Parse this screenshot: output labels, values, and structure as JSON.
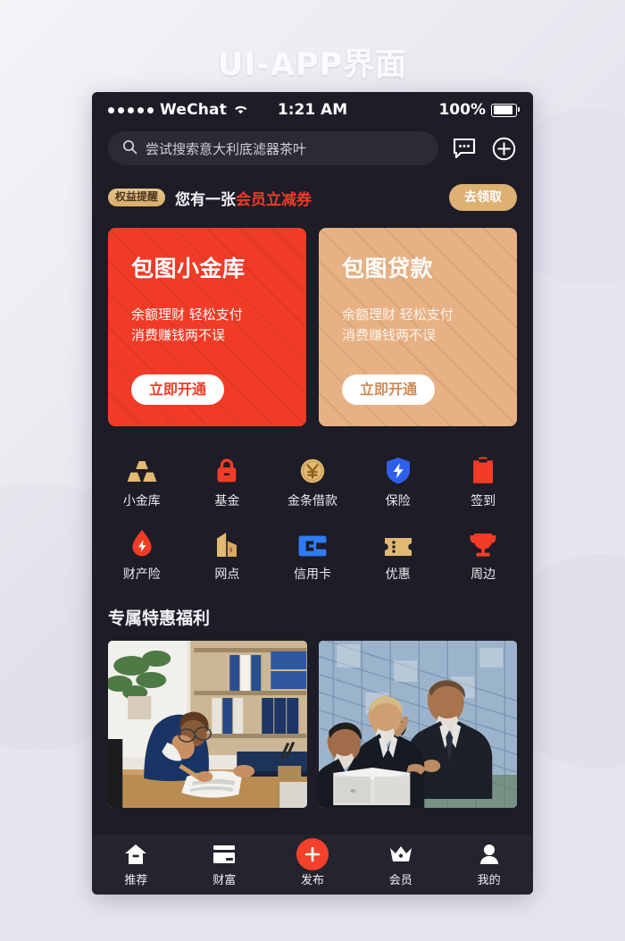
{
  "page": {
    "title": "UI-APP界面"
  },
  "statusbar": {
    "carrier": "WeChat",
    "time": "1:21 AM",
    "battery_percent": "100%",
    "signal_dots": 5,
    "wifi_icon": "wifi-icon",
    "battery_icon": "battery-full-icon"
  },
  "search": {
    "placeholder": "尝试搜索意大利底滤器茶叶",
    "icon": "search-icon",
    "message_icon": "message-bubble-icon",
    "add_icon": "plus-circle-icon"
  },
  "notice": {
    "badge": "权益提醒",
    "text_prefix": "您有一张",
    "text_highlight": "会员立减券",
    "button": "去领取",
    "badge_color": "#d9ad6c",
    "highlight_color": "#ef3b26",
    "button_color": "#dcb173"
  },
  "promo_cards": [
    {
      "title": "包图小金库",
      "sub_line1": "余额理财 轻松支付",
      "sub_line2": "消费赚钱两不误",
      "button": "立即开通",
      "bg_color": "#f03c27",
      "button_text_color": "#f03c27"
    },
    {
      "title": "包图贷款",
      "sub_line1": "余额理财 轻松支付",
      "sub_line2": "消费赚钱两不误",
      "button": "立即开通",
      "bg_color": "#e8b184",
      "button_text_color": "#cf8a55"
    }
  ],
  "quick_grid": {
    "row1": [
      {
        "label": "小金库",
        "icon": "gold-bars-icon",
        "color": "#e2b972"
      },
      {
        "label": "基金",
        "icon": "lock-bag-icon",
        "color": "#f23c26"
      },
      {
        "label": "金条借款",
        "icon": "yuan-coin-icon",
        "color": "#e2b972"
      },
      {
        "label": "保险",
        "icon": "shield-bolt-icon",
        "color": "#2f5fe8"
      },
      {
        "label": "签到",
        "icon": "clipboard-icon",
        "color": "#f23c26"
      }
    ],
    "row2": [
      {
        "label": "财产险",
        "icon": "droplet-bolt-icon",
        "color": "#f23c26"
      },
      {
        "label": "网点",
        "icon": "building-icon",
        "color": "#e2b972"
      },
      {
        "label": "信用卡",
        "icon": "credit-card-icon",
        "color": "#2f7bf5"
      },
      {
        "label": "优惠",
        "icon": "ticket-icon",
        "color": "#e2b972"
      },
      {
        "label": "周边",
        "icon": "trophy-icon",
        "color": "#f23c26"
      }
    ]
  },
  "section": {
    "title": "专属特惠福利"
  },
  "photos": [
    {
      "alt": "businesswoman-writing-at-desk"
    },
    {
      "alt": "business-team-outside-glass-building"
    }
  ],
  "tabbar": [
    {
      "label": "推荐",
      "icon": "home-icon",
      "active": true
    },
    {
      "label": "财富",
      "icon": "card-icon",
      "active": false
    },
    {
      "label": "发布",
      "icon": "plus-fab-icon",
      "active": false
    },
    {
      "label": "会员",
      "icon": "crown-icon",
      "active": false
    },
    {
      "label": "我的",
      "icon": "person-icon",
      "active": false
    }
  ],
  "colors": {
    "app_bg": "#1d1c27",
    "tabbar_bg": "#24232e",
    "page_bg": "#e7e6ee",
    "accent_red": "#f3412c",
    "accent_tan": "#dcb173"
  }
}
